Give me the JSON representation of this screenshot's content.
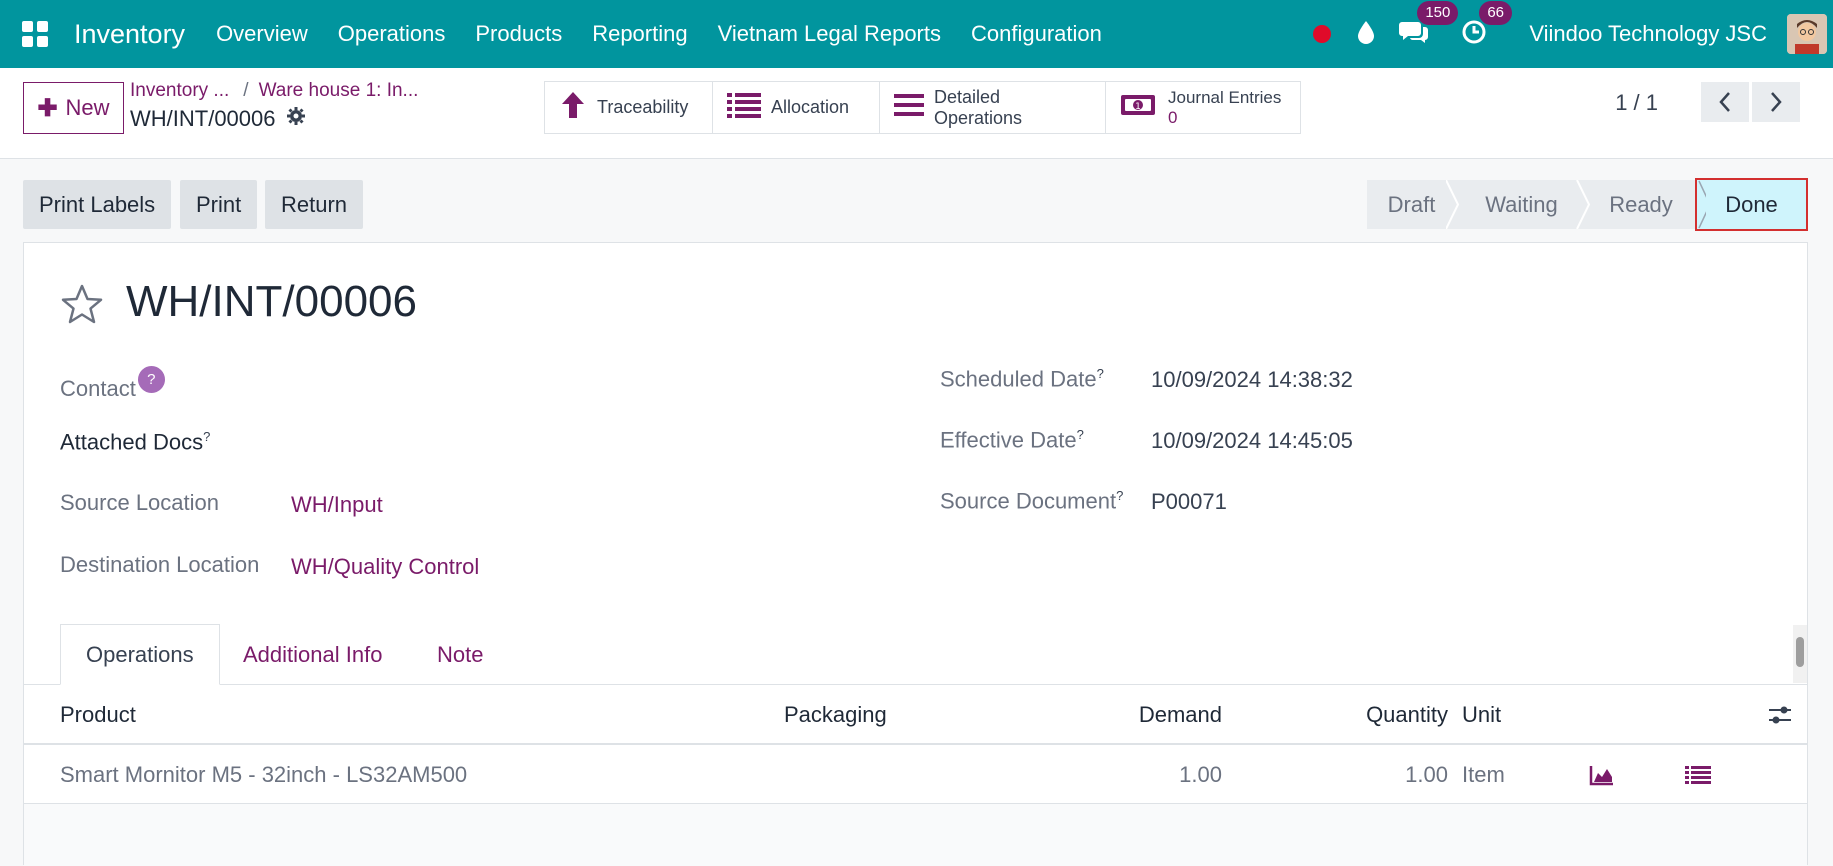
{
  "navbar": {
    "app_name": "Inventory",
    "menu": [
      "Overview",
      "Operations",
      "Products",
      "Reporting",
      "Vietnam Legal Reports",
      "Configuration"
    ],
    "messages_count": "150",
    "activities_count": "66",
    "company": "Viindoo Technology JSC",
    "color": "#01959e"
  },
  "control": {
    "new_label": "New",
    "breadcrumb_1": "Inventory ...",
    "breadcrumb_sep": "/",
    "breadcrumb_2": "Ware house 1: In...",
    "current_record": "WH/INT/00006",
    "smart_buttons": {
      "traceability": "Traceability",
      "allocation": "Allocation",
      "detailed_operations": "Detailed Operations",
      "journal_entries": "Journal Entries",
      "journal_entries_count": "0"
    },
    "pager": "1 / 1"
  },
  "statusbar": {
    "buttons": [
      "Print Labels",
      "Print",
      "Return"
    ],
    "stages": [
      "Draft",
      "Waiting",
      "Ready",
      "Done"
    ],
    "current_stage": "Done"
  },
  "form": {
    "name": "WH/INT/00006",
    "contact_label": "Contact",
    "contact_help": "?",
    "attached_docs_label": "Attached Docs",
    "help_mark": "?",
    "source_location_label": "Source Location",
    "source_location": "WH/Input",
    "destination_location_label": "Destination Location",
    "destination_location": "WH/Quality Control",
    "scheduled_date_label": "Scheduled Date",
    "scheduled_date": "10/09/2024 14:38:32",
    "effective_date_label": "Effective Date",
    "effective_date": "10/09/2024 14:45:05",
    "source_document_label": "Source Document",
    "source_document": "P00071"
  },
  "tabs": [
    "Operations",
    "Additional Info",
    "Note"
  ],
  "table": {
    "headers": {
      "product": "Product",
      "packaging": "Packaging",
      "demand": "Demand",
      "quantity": "Quantity",
      "unit": "Unit"
    },
    "rows": [
      {
        "product": "Smart Mornitor M5 - 32inch - LS32AM500",
        "packaging": "",
        "demand": "1.00",
        "quantity": "1.00",
        "unit": "Item"
      }
    ]
  }
}
